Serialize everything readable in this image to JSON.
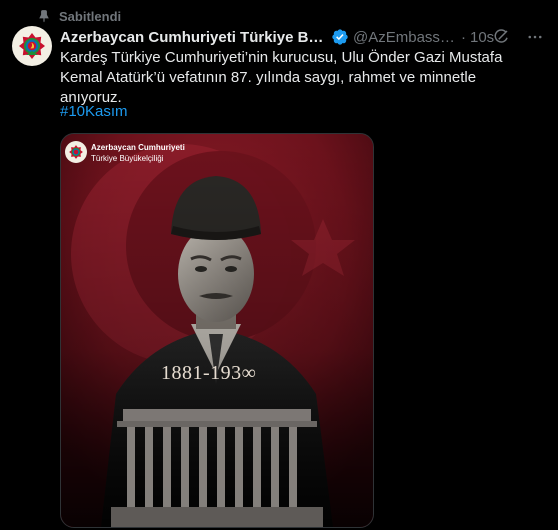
{
  "pinned": {
    "label": "Sabitlendi",
    "icon": "pin-icon"
  },
  "author": {
    "display_name": "Azerbaycan Cumhuriyeti Türkiye Büyü...",
    "handle": "@AzEmbassyT...",
    "verified": true,
    "verified_icon": "verified-badge-icon",
    "time": "10s",
    "avatar_icon": "azerbaijan-emblem-icon"
  },
  "tweet": {
    "text": "Kardeş Türkiye Cumhuriyeti’nin kurucusu, Ulu Önder Gazi Mustafa Kemal Atatürk’ü vefatının 87. yılında saygı, rahmet ve minnetle anıyoruz.",
    "hashtag": "#10Kasım"
  },
  "media": {
    "org_line1": "Azerbaycan Cumhuriyeti",
    "org_line2": "Türkiye Büyükelçiliği",
    "years": "1881-193∞",
    "description_icon": "ataturk-portrait-image"
  },
  "colors": {
    "background": "#000000",
    "text_primary": "#e7e9ea",
    "text_secondary": "#71767b",
    "link": "#1d9bf0",
    "verified": "#1d9bf0",
    "media_red": "#7a1622"
  }
}
